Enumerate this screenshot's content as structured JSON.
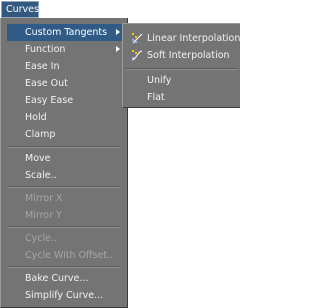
{
  "menubar": {
    "title": "Curves"
  },
  "menu": {
    "items": [
      {
        "label": "Custom Tangents",
        "submenu": true,
        "state": "highlighted"
      },
      {
        "label": "Function",
        "submenu": true
      },
      {
        "label": "Ease In"
      },
      {
        "label": "Ease Out"
      },
      {
        "label": "Easy Ease"
      },
      {
        "label": "Hold"
      },
      {
        "label": "Clamp"
      },
      {
        "label": "Move"
      },
      {
        "label": "Scale.."
      },
      {
        "label": "Mirror X",
        "state": "disabled"
      },
      {
        "label": "Mirror Y",
        "state": "disabled"
      },
      {
        "label": "Cycle..",
        "state": "disabled"
      },
      {
        "label": "Cycle With Offset..",
        "state": "disabled"
      },
      {
        "label": "Bake Curve..."
      },
      {
        "label": "Simplify Curve..."
      }
    ]
  },
  "submenu": {
    "items": [
      {
        "label": "Linear Interpolation",
        "icon": "linear-interpolation-icon"
      },
      {
        "label": "Soft Interpolation",
        "icon": "soft-interpolation-icon"
      },
      {
        "label": "Unify"
      },
      {
        "label": "Flat"
      }
    ]
  },
  "colors": {
    "menu_bg": "#747474",
    "highlight": "#2f5b86",
    "menubar_active": "#34597f",
    "text": "#f2f2f2",
    "disabled_text": "#a7a7a7",
    "icon_yellow": "#e8d000",
    "icon_blue": "#8fb4ff"
  }
}
